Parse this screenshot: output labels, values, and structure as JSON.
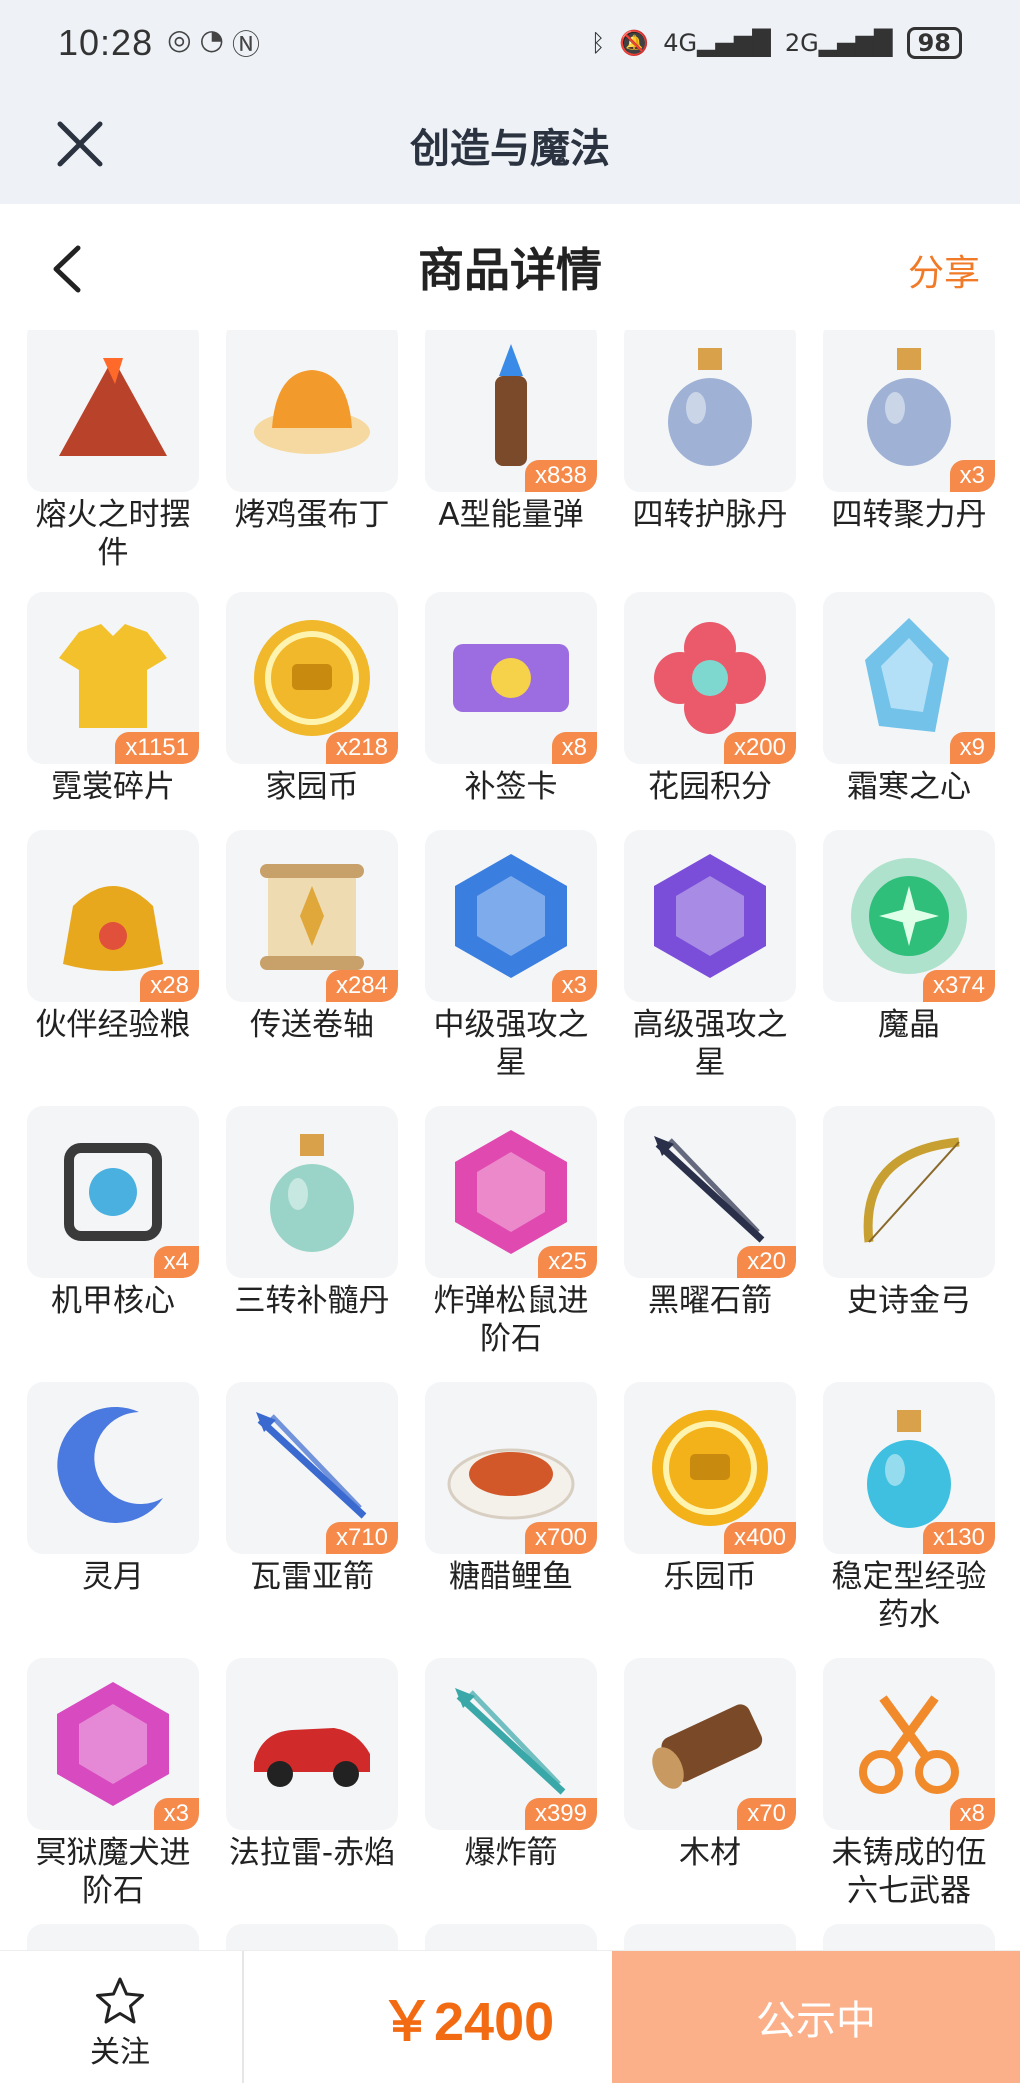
{
  "status_bar": {
    "time": "10:28",
    "net1": "4G",
    "net2": "2G",
    "battery": "98"
  },
  "app": {
    "title": "创造与魔法"
  },
  "page": {
    "title": "商品详情",
    "share_label": "分享"
  },
  "items": [
    {
      "name": "熔火之时摆件",
      "qty": "",
      "icon": "volcano-icon",
      "color": "#b8432a"
    },
    {
      "name": "烤鸡蛋布丁",
      "qty": "",
      "icon": "pudding-icon",
      "color": "#f39a2c"
    },
    {
      "name": "A型能量弹",
      "qty": "x838",
      "icon": "energy-bullet-icon",
      "color": "#7a4a2a"
    },
    {
      "name": "四转护脉丹",
      "qty": "",
      "icon": "potion-bottle-icon",
      "color": "#9fb2d6"
    },
    {
      "name": "四转聚力丹",
      "qty": "x3",
      "icon": "potion-bottle-icon",
      "color": "#9fb2d6"
    },
    {
      "name": "霓裳碎片",
      "qty": "x1151",
      "icon": "shirt-icon",
      "color": "#f2c12c"
    },
    {
      "name": "家园币",
      "qty": "x218",
      "icon": "coin-icon",
      "color": "#f0b82a"
    },
    {
      "name": "补签卡",
      "qty": "x8",
      "icon": "ticket-icon",
      "color": "#9b6de0"
    },
    {
      "name": "花园积分",
      "qty": "x200",
      "icon": "flower-icon",
      "color": "#ea5a6a"
    },
    {
      "name": "霜寒之心",
      "qty": "x9",
      "icon": "ice-crystal-icon",
      "color": "#5ab8e8"
    },
    {
      "name": "伙伴经验粮",
      "qty": "x28",
      "icon": "food-bag-icon",
      "color": "#e8a81e"
    },
    {
      "name": "传送卷轴",
      "qty": "x284",
      "icon": "scroll-icon",
      "color": "#c7a06a"
    },
    {
      "name": "中级强攻之星",
      "qty": "x3",
      "icon": "blue-gem-icon",
      "color": "#3a7fe0"
    },
    {
      "name": "高级强攻之星",
      "qty": "",
      "icon": "purple-gem-icon",
      "color": "#7a4ed8"
    },
    {
      "name": "魔晶",
      "qty": "x374",
      "icon": "green-orb-icon",
      "color": "#2fbf7a"
    },
    {
      "name": "机甲核心",
      "qty": "x4",
      "icon": "mech-core-icon",
      "color": "#3a3a3a"
    },
    {
      "name": "三转补髓丹",
      "qty": "",
      "icon": "vase-icon",
      "color": "#9ad4c8"
    },
    {
      "name": "炸弹松鼠进阶石",
      "qty": "x25",
      "icon": "pink-gem-icon",
      "color": "#e04ab0"
    },
    {
      "name": "黑曜石箭",
      "qty": "x20",
      "icon": "arrow-icon",
      "color": "#2a2f4a"
    },
    {
      "name": "史诗金弓",
      "qty": "",
      "icon": "bow-icon",
      "color": "#c8a032"
    },
    {
      "name": "灵月",
      "qty": "",
      "icon": "moon-icon",
      "color": "#4a7ae0"
    },
    {
      "name": "瓦雷亚箭",
      "qty": "x710",
      "icon": "arrow-icon",
      "color": "#3a6ad0"
    },
    {
      "name": "糖醋鲤鱼",
      "qty": "x700",
      "icon": "fish-dish-icon",
      "color": "#d2582a"
    },
    {
      "name": "乐园币",
      "qty": "x400",
      "icon": "coin-icon",
      "color": "#f3b11a"
    },
    {
      "name": "稳定型经验药水",
      "qty": "x130",
      "icon": "potion-icon",
      "color": "#3fc0e0"
    },
    {
      "name": "冥狱魔犬进阶石",
      "qty": "x3",
      "icon": "pink-gem-icon",
      "color": "#d84ac0"
    },
    {
      "name": "法拉雷-赤焰",
      "qty": "",
      "icon": "car-icon",
      "color": "#d02a2a"
    },
    {
      "name": "爆炸箭",
      "qty": "x399",
      "icon": "arrow-icon",
      "color": "#3aa8a8"
    },
    {
      "name": "木材",
      "qty": "x70",
      "icon": "log-icon",
      "color": "#7a4a28"
    },
    {
      "name": "未铸成的伍六七武器",
      "qty": "x8",
      "icon": "scissors-icon",
      "color": "#f08a2a"
    }
  ],
  "bottom": {
    "follow_label": "关注",
    "price": "￥2400",
    "status_label": "公示中"
  }
}
